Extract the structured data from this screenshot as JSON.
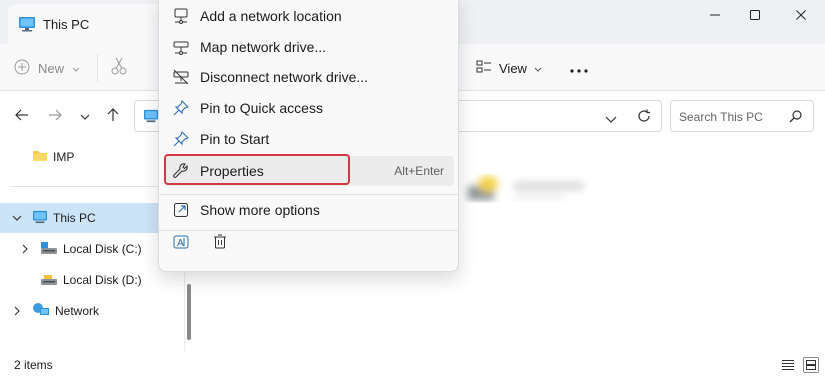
{
  "window": {
    "tab_title": "This PC",
    "minimize_icon": "minimize-icon",
    "maximize_icon": "maximize-icon",
    "close_icon": "close-icon"
  },
  "toolbar": {
    "new_label": "New",
    "view_label": "View"
  },
  "search": {
    "placeholder": "Search This PC"
  },
  "sidebar": {
    "items": [
      {
        "label": "IMP",
        "icon": "folder-icon"
      },
      {
        "label": "This PC",
        "icon": "computer-icon",
        "selected": true
      },
      {
        "label": "Local Disk (C:)",
        "icon": "drive-icon"
      },
      {
        "label": "Local Disk (D:)",
        "icon": "drive-icon"
      },
      {
        "label": "Network",
        "icon": "network-icon"
      }
    ]
  },
  "status": {
    "items_count": "2 items"
  },
  "context_menu": {
    "items": [
      {
        "label": "Add a network location",
        "icon": "network-location-icon"
      },
      {
        "label": "Map network drive...",
        "icon": "map-drive-icon"
      },
      {
        "label": "Disconnect network drive...",
        "icon": "disconnect-drive-icon"
      },
      {
        "label": "Pin to Quick access",
        "icon": "pin-icon"
      },
      {
        "label": "Pin to Start",
        "icon": "pin-icon"
      },
      {
        "label": "Properties",
        "icon": "wrench-icon",
        "shortcut": "Alt+Enter"
      },
      {
        "label": "Show more options",
        "icon": "more-options-icon"
      }
    ],
    "footer_icons": [
      "rename-icon",
      "delete-icon"
    ]
  },
  "colors": {
    "selection": "#cce4f7",
    "accent": "#0067c0",
    "highlight_border": "#d63745"
  }
}
